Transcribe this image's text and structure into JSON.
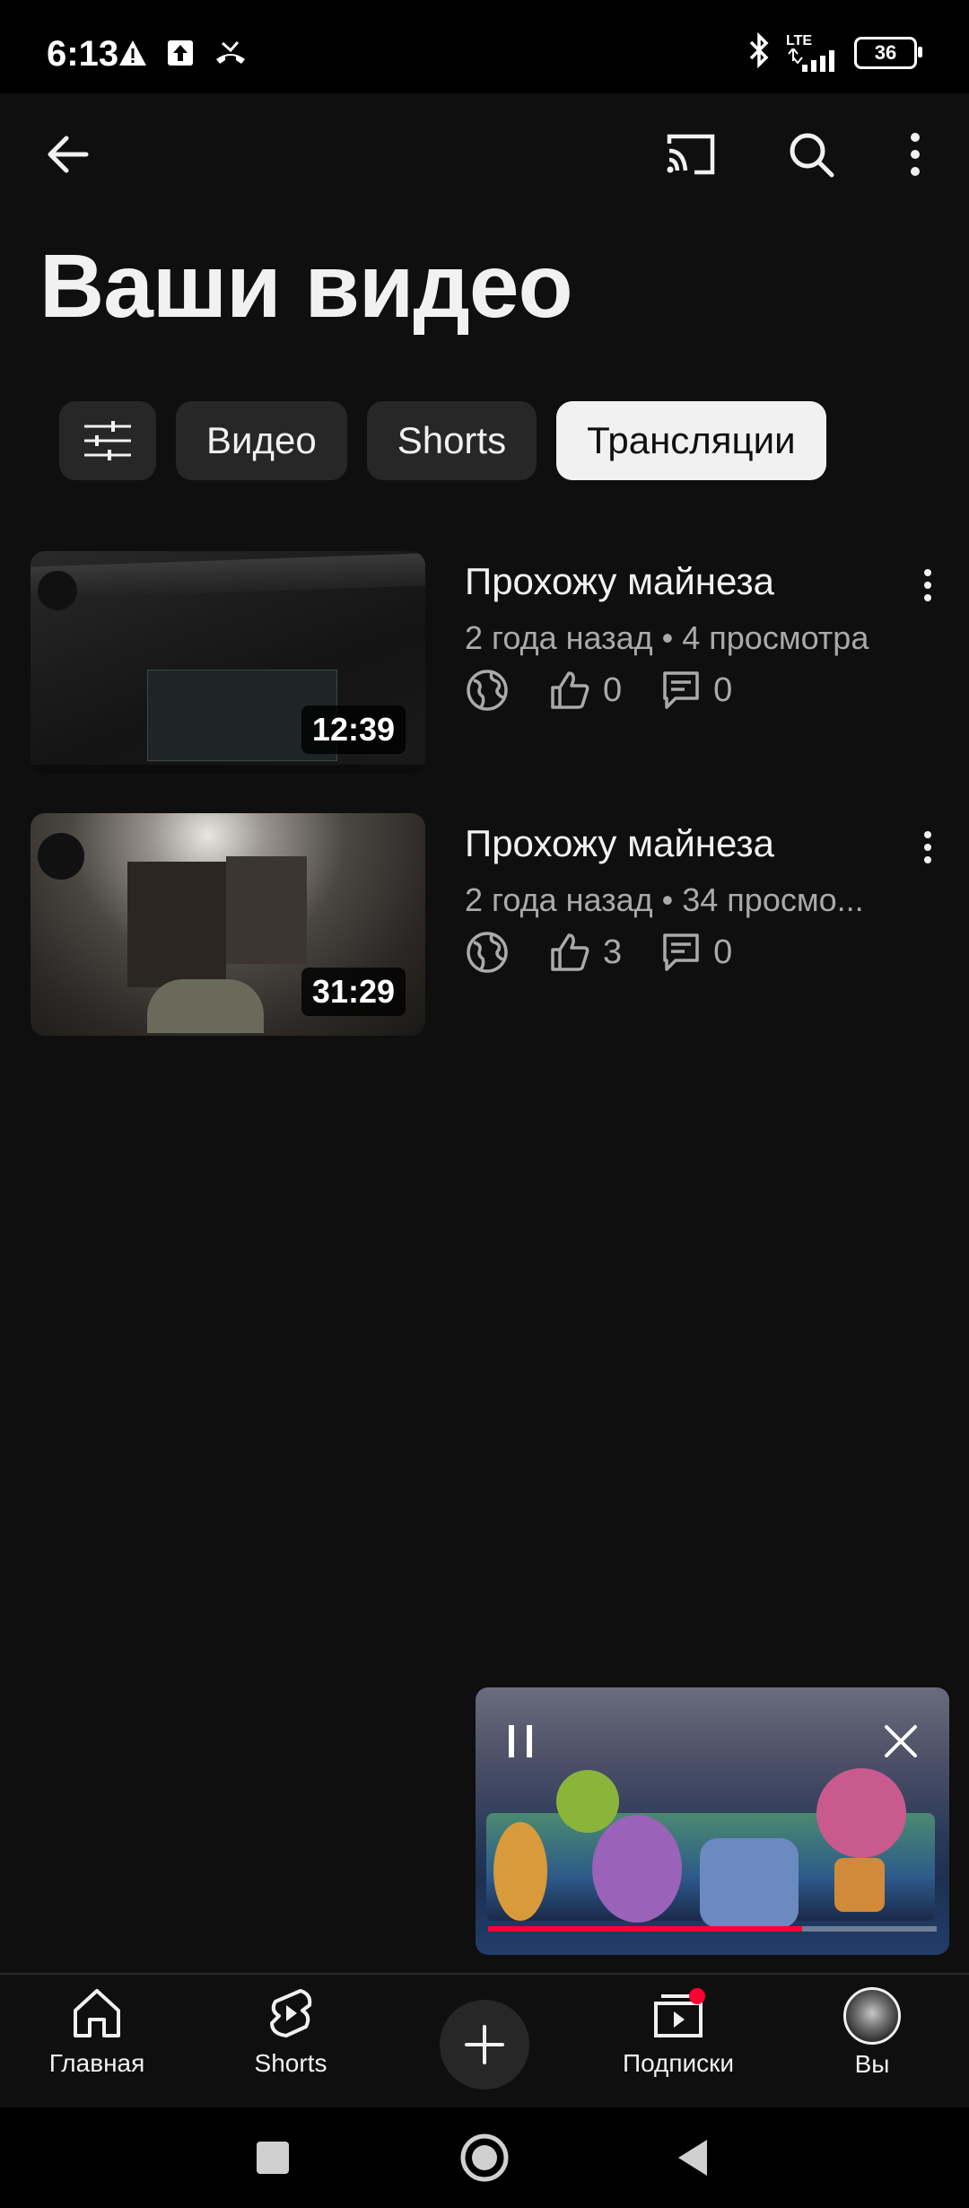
{
  "status_bar": {
    "time": "6:13",
    "network": "LTE",
    "battery": "36",
    "icons": [
      "warning-icon",
      "upload-icon",
      "missed-call-icon",
      "bluetooth-icon",
      "signal-icon"
    ]
  },
  "app_bar": {
    "icons": [
      "back-arrow-icon",
      "cast-icon",
      "search-icon",
      "more-vert-icon"
    ]
  },
  "page": {
    "title": "Ваши видео"
  },
  "chips": [
    {
      "label": "Видео"
    },
    {
      "label": "Shorts"
    },
    {
      "label": "Трансляции",
      "active": true
    }
  ],
  "videos": [
    {
      "title": "Прохожу майнеза",
      "meta": "2 года назад • 4 просмотра",
      "duration": "12:39",
      "likes": "0",
      "comments": "0"
    },
    {
      "title": "Прохожу майнеза",
      "meta": "2 года назад • 34 просмо...",
      "duration": "31:29",
      "likes": "3",
      "comments": "0"
    }
  ],
  "mini_player": {
    "progress": 0.7,
    "colors": {
      "progress": "#ff0033"
    }
  },
  "bottom_nav": {
    "home": "Главная",
    "shorts": "Shorts",
    "subscriptions": "Подписки",
    "you": "Вы"
  }
}
